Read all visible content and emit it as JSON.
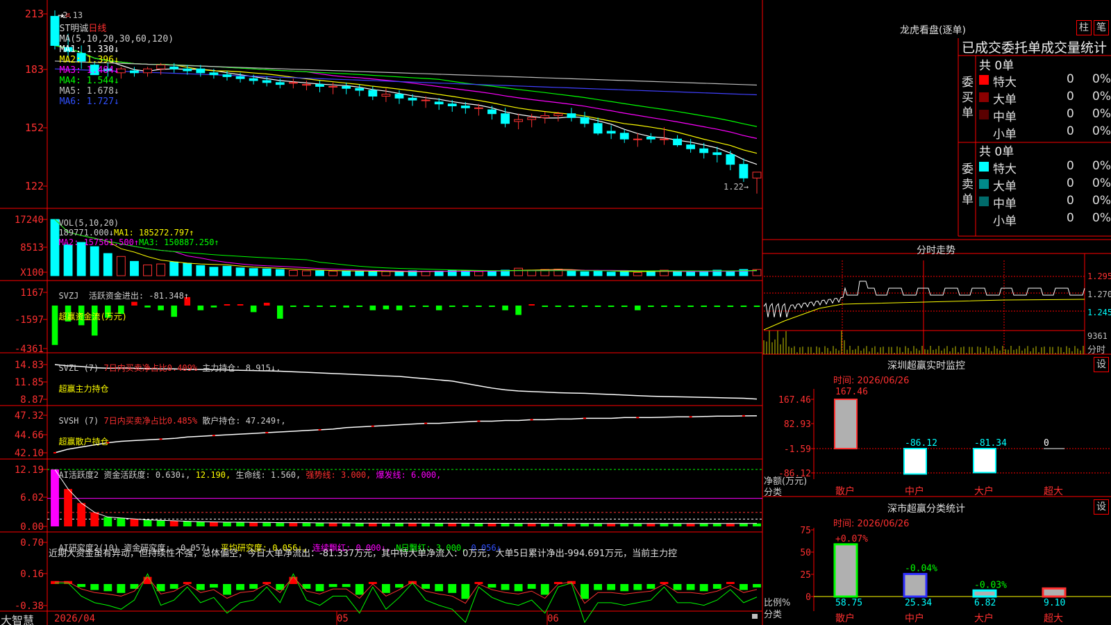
{
  "chart_data": {
    "type": "candlestick",
    "dates": [
      "2026/04/09",
      "2026/04/10",
      "2026/04/13",
      "2026/04/14",
      "2026/04/15",
      "2026/04/16",
      "2026/04/17",
      "2026/04/20",
      "2026/04/21",
      "2026/04/22",
      "2026/04/23",
      "2026/04/24",
      "2026/04/27",
      "2026/04/28",
      "2026/04/29",
      "2026/04/30",
      "2026/05/06",
      "2026/05/07",
      "2026/05/08",
      "2026/05/11",
      "2026/05/12",
      "2026/05/13",
      "2026/05/14",
      "2026/05/15",
      "2026/05/18",
      "2026/05/19",
      "2026/05/20",
      "2026/05/21",
      "2026/05/22",
      "2026/05/25",
      "2026/05/26",
      "2026/05/27",
      "2026/05/28",
      "2026/05/29",
      "2026/06/01",
      "2026/06/02",
      "2026/06/03",
      "2026/06/04",
      "2026/06/05",
      "2026/06/08",
      "2026/06/09",
      "2026/06/10",
      "2026/06/11",
      "2026/06/12",
      "2026/06/15",
      "2026/06/16",
      "2026/06/17",
      "2026/06/18",
      "2026/06/19",
      "2026/06/22",
      "2026/06/23",
      "2026/06/24",
      "2026/06/25",
      "2026/06/26"
    ],
    "open": [
      2.13,
      1.97,
      1.94,
      1.88,
      1.86,
      1.84,
      1.85,
      1.84,
      1.86,
      1.87,
      1.86,
      1.86,
      1.84,
      1.83,
      1.82,
      1.81,
      1.8,
      1.79,
      1.79,
      1.78,
      1.78,
      1.77,
      1.77,
      1.76,
      1.75,
      1.72,
      1.73,
      1.71,
      1.7,
      1.69,
      1.68,
      1.67,
      1.66,
      1.65,
      1.63,
      1.59,
      1.6,
      1.61,
      1.62,
      1.63,
      1.61,
      1.58,
      1.54,
      1.53,
      1.5,
      1.51,
      1.5,
      1.5,
      1.47,
      1.45,
      1.43,
      1.42,
      1.37,
      1.3
    ],
    "high": [
      2.16,
      2.04,
      1.98,
      1.9,
      1.89,
      1.87,
      1.87,
      1.87,
      1.89,
      1.89,
      1.88,
      1.88,
      1.86,
      1.85,
      1.84,
      1.83,
      1.82,
      1.81,
      1.81,
      1.8,
      1.8,
      1.79,
      1.79,
      1.78,
      1.77,
      1.76,
      1.75,
      1.73,
      1.72,
      1.71,
      1.7,
      1.69,
      1.68,
      1.67,
      1.66,
      1.63,
      1.63,
      1.64,
      1.64,
      1.66,
      1.64,
      1.61,
      1.57,
      1.55,
      1.53,
      1.53,
      1.56,
      1.52,
      1.5,
      1.48,
      1.46,
      1.44,
      1.4,
      1.33
    ],
    "low": [
      1.96,
      1.92,
      1.86,
      1.83,
      1.82,
      1.81,
      1.82,
      1.82,
      1.83,
      1.84,
      1.83,
      1.82,
      1.81,
      1.8,
      1.79,
      1.78,
      1.77,
      1.76,
      1.76,
      1.75,
      1.74,
      1.73,
      1.73,
      1.72,
      1.7,
      1.69,
      1.68,
      1.67,
      1.66,
      1.65,
      1.64,
      1.63,
      1.62,
      1.6,
      1.56,
      1.55,
      1.56,
      1.58,
      1.59,
      1.59,
      1.56,
      1.52,
      1.5,
      1.48,
      1.46,
      1.48,
      1.47,
      1.46,
      1.43,
      1.4,
      1.38,
      1.34,
      1.28,
      1.22
    ],
    "close": [
      1.98,
      1.95,
      1.9,
      1.83,
      1.85,
      1.86,
      1.84,
      1.86,
      1.88,
      1.86,
      1.85,
      1.84,
      1.83,
      1.82,
      1.81,
      1.8,
      1.79,
      1.78,
      1.79,
      1.78,
      1.77,
      1.77,
      1.76,
      1.75,
      1.72,
      1.73,
      1.71,
      1.7,
      1.7,
      1.68,
      1.67,
      1.66,
      1.66,
      1.63,
      1.58,
      1.6,
      1.61,
      1.62,
      1.63,
      1.61,
      1.58,
      1.53,
      1.53,
      1.5,
      1.5,
      1.5,
      1.5,
      1.47,
      1.45,
      1.43,
      1.42,
      1.37,
      1.3,
      1.33
    ],
    "volume": [
      17240,
      9500,
      10200,
      8900,
      6800,
      5900,
      4400,
      3300,
      3600,
      4200,
      3800,
      3100,
      2600,
      2900,
      2400,
      2200,
      2100,
      1900,
      1600,
      1500,
      1500,
      1400,
      1500,
      1300,
      1200,
      1300,
      1100,
      1500,
      1300,
      1400,
      1700,
      1500,
      1300,
      1500,
      1700,
      2300,
      1700,
      1900,
      2000,
      1400,
      1200,
      1600,
      1100,
      1300,
      1000,
      1500,
      1700,
      1200,
      1100,
      1300,
      1700,
      1500,
      1900,
      1898
    ],
    "fund_flow": [
      -4200,
      -1700,
      -2100,
      -3200,
      -1300,
      -900,
      400,
      -200,
      -500,
      -1200,
      900,
      -500,
      -200,
      100,
      100,
      -700,
      300,
      -1400,
      -50,
      -50,
      -60,
      -50,
      -200,
      -40,
      -500,
      -400,
      -500,
      -60,
      -60,
      -500,
      -50,
      -50,
      -40,
      -50,
      -500,
      -1000,
      100,
      -40,
      -60,
      -50,
      -40,
      -40,
      -40,
      -40,
      -500,
      -30,
      -40,
      -30,
      -30,
      -40,
      -40,
      -40,
      -40,
      -40
    ],
    "main_pos": [
      14.83,
      14.6,
      14.5,
      14.3,
      14.2,
      14.25,
      14.2,
      14.15,
      14.1,
      14.1,
      14.0,
      14.0,
      13.95,
      13.9,
      13.85,
      13.8,
      13.75,
      13.7,
      13.6,
      13.5,
      13.4,
      13.3,
      13.2,
      13.1,
      13.0,
      12.9,
      12.8,
      12.6,
      12.4,
      12.2,
      12.0,
      11.6,
      11.2,
      10.8,
      10.5,
      10.3,
      10.2,
      10.1,
      10.0,
      9.95,
      9.9,
      9.8,
      9.7,
      9.6,
      9.5,
      9.4,
      9.35,
      9.3,
      9.25,
      9.2,
      9.15,
      9.1,
      9.05,
      8.915
    ],
    "retail_pos": [
      42.1,
      42.6,
      42.9,
      43.2,
      43.5,
      43.7,
      43.8,
      43.9,
      44.0,
      44.1,
      44.3,
      44.4,
      44.5,
      44.6,
      44.7,
      44.8,
      44.9,
      45.0,
      45.1,
      45.2,
      45.3,
      45.4,
      45.6,
      45.7,
      45.8,
      45.9,
      46.0,
      46.1,
      46.2,
      46.2,
      46.3,
      46.4,
      46.5,
      46.5,
      46.6,
      46.6,
      46.7,
      46.7,
      46.8,
      46.8,
      46.9,
      46.9,
      46.9,
      47.0,
      47.0,
      47.0,
      47.05,
      47.1,
      47.1,
      47.15,
      47.2,
      47.2,
      47.24,
      47.249
    ],
    "activity": [
      12.19,
      8.0,
      5.0,
      3.0,
      2.0,
      1.8,
      1.6,
      1.4,
      1.3,
      1.2,
      1.1,
      1.0,
      0.95,
      0.9,
      0.9,
      0.85,
      0.85,
      0.8,
      0.8,
      0.8,
      0.75,
      0.75,
      0.75,
      0.7,
      0.7,
      0.7,
      0.7,
      0.7,
      0.7,
      0.68,
      0.68,
      0.68,
      0.66,
      0.66,
      0.66,
      0.65,
      0.65,
      0.65,
      0.65,
      0.64,
      0.64,
      0.64,
      0.64,
      0.64,
      0.63,
      0.63,
      0.63,
      0.63,
      0.63,
      0.63,
      0.63,
      0.63,
      0.63,
      0.63
    ],
    "research": [
      0.05,
      0.05,
      -0.05,
      -0.1,
      -0.12,
      -0.15,
      -0.08,
      0.12,
      -0.12,
      -0.08,
      0.02,
      -0.1,
      -0.06,
      -0.18,
      -0.1,
      -0.08,
      0.02,
      -0.1,
      0.12,
      -0.08,
      -0.12,
      -0.05,
      -0.05,
      -0.18,
      0.02,
      -0.15,
      -0.06,
      0.05,
      -0.08,
      -0.12,
      -0.15,
      -0.25,
      0.02,
      -0.06,
      -0.1,
      -0.12,
      -0.08,
      -0.18,
      0.02,
      0.05,
      -0.25,
      -0.1,
      -0.1,
      -0.12,
      -0.1,
      -0.08,
      0.02,
      -0.1,
      -0.1,
      -0.12,
      -0.08,
      0.0,
      -0.1,
      -0.057
    ],
    "price_axis": {
      "min": 1.18,
      "max": 2.16,
      "ticks": [
        "213",
        "183",
        "152",
        "122"
      ]
    },
    "vol_axis": {
      "ticks": [
        "17240",
        "8513",
        "X100"
      ]
    },
    "flow_axis": {
      "ticks": [
        "1167",
        "-1597",
        "-4361"
      ]
    },
    "main_axis": {
      "ticks": [
        "14.83",
        "11.85",
        "8.87"
      ]
    },
    "retail_axis": {
      "ticks": [
        "47.32",
        "44.66",
        "42.10"
      ]
    },
    "act_axis": {
      "ticks": [
        "12.19",
        "6.02",
        "0.00"
      ]
    },
    "res_axis": {
      "ticks": [
        "0.70",
        "0.16",
        "-0.38"
      ]
    },
    "x_labels": [
      "2026/04",
      "05",
      "06"
    ]
  },
  "main": {
    "title": "ST明诚",
    "period": "日线",
    "ma_params": "MA(5,10,20,30,60,120)",
    "ma1": "MA1: 1.330↓",
    "ma2": "MA2: 1.396↓",
    "ma3": "MA3: 1.484↓",
    "ma4": "MA4: 1.544↓",
    "ma5": "MA5: 1.678↓",
    "ma6": "MA6: 1.727↓",
    "high_mark": "2.13",
    "low_mark": "1.22→"
  },
  "vol": {
    "label": "VOL(5,10,20)",
    "value": "189771.000↓",
    "ma1": "MA1: 185272.797↑",
    "ma2": "MA2: 157561.500↑",
    "ma3": "MA3: 150887.250↑"
  },
  "svzj": {
    "label": "SVZJ",
    "title": "活跃资金进出: -81.348↑",
    "sub": "超赢资金流(万元)"
  },
  "svzl": {
    "label": "SVZL (7)",
    "ratio": "7日内买卖净占比0.409%",
    "hold": "主力持仓: 8.915↓,",
    "sub": "超赢主力持仓"
  },
  "svsh": {
    "label": "SVSH (7)",
    "ratio": "7日内买卖净占比0.485%",
    "hold": "散户持仓: 47.249↑,",
    "sub": "超赢散户持仓"
  },
  "ai1": {
    "label": "AI活跃度2",
    "act": "资金活跃度: 0.630↓,",
    "v2": "12.190,",
    "life": "生命线: 1.560,",
    "strong": "强势线: 3.000,",
    "burst": "爆发线: 6.000,"
  },
  "ai2": {
    "label": "AI研究度2(10)",
    "res": "资金研究度: -0.057↓,",
    "avg": "平均研究度: 0.056↓,",
    "red": "连续飘红: 0.000↓,",
    "nred": "N日飘红: 3.000,",
    "last": "0.056↓"
  },
  "comment": "近期大资金虽有异动，但持续性不强，总体偏空，今日大单净流出：-81.337万元，其中特大单净流入：0万元，大单5日累计净出-994.691万元，当前主力控",
  "brand": "大智慧",
  "dragon": {
    "title": "龙虎看盘(逐单)",
    "btn_col": "柱",
    "btn_pen": "笔",
    "stats_title": "已成交委托单成交量统计",
    "buy_label": "委买单",
    "sell_label": "委卖单",
    "buy_total": "共 0单",
    "sell_total": "共 0单",
    "buy_rows": [
      {
        "name": "特大",
        "num": "0",
        "pct": "0%",
        "color": "#ff0000"
      },
      {
        "name": "大单",
        "num": "0",
        "pct": "0%",
        "color": "#8b0000"
      },
      {
        "name": "中单",
        "num": "0",
        "pct": "0%",
        "color": "#5a0000"
      },
      {
        "name": "小单",
        "num": "0",
        "pct": "0%",
        "color": ""
      }
    ],
    "sell_rows": [
      {
        "name": "特大",
        "num": "0",
        "pct": "0%",
        "color": "#00ffff"
      },
      {
        "name": "大单",
        "num": "0",
        "pct": "0%",
        "color": "#008b8b"
      },
      {
        "name": "中单",
        "num": "0",
        "pct": "0%",
        "color": "#006b6b"
      },
      {
        "name": "小单",
        "num": "0",
        "pct": "0%",
        "color": ""
      }
    ]
  },
  "intraday": {
    "title": "分时走势",
    "prices": [
      "1.295",
      "1.270",
      "1.245"
    ],
    "vol": "9361",
    "vol_unit": "分时"
  },
  "monitor": {
    "title": "深圳超赢实时监控",
    "btn": "设",
    "time": "时间: 2026/06/26",
    "axis": [
      "167.46",
      "82.93",
      "-1.59",
      "-86.12"
    ],
    "unit": "净额(万元)",
    "cat_label": "分类",
    "cats": [
      "散户",
      "中户",
      "大户",
      "超大"
    ],
    "values": [
      167.46,
      -86.12,
      -81.34,
      0
    ],
    "value_labels": [
      "167.46",
      "-86.12",
      "-81.34",
      "0"
    ]
  },
  "classify": {
    "title": "深市超赢分类统计",
    "btn": "设",
    "time": "时间: 2026/06/26",
    "axis": [
      "75",
      "50",
      "25",
      "0"
    ],
    "unit": "比例%",
    "cat_label": "分类",
    "cats": [
      "散户",
      "中户",
      "大户",
      "超大"
    ],
    "values": [
      58.75,
      25.34,
      6.82,
      9.1
    ],
    "value_labels": [
      "58.75",
      "25.34",
      "6.82",
      "9.10"
    ],
    "change_labels": [
      "+0.07%",
      "-0.04%",
      "-0.03%",
      ""
    ]
  },
  "colors": {
    "up": "#ff3232",
    "down": "#00ffff",
    "grid": "#ff0000",
    "ma1": "#ffffff",
    "ma2": "#ffff00",
    "ma3": "#ff00ff",
    "ma4": "#00ff00",
    "ma5": "#4040ff",
    "ma6": "#c0c0c0"
  }
}
